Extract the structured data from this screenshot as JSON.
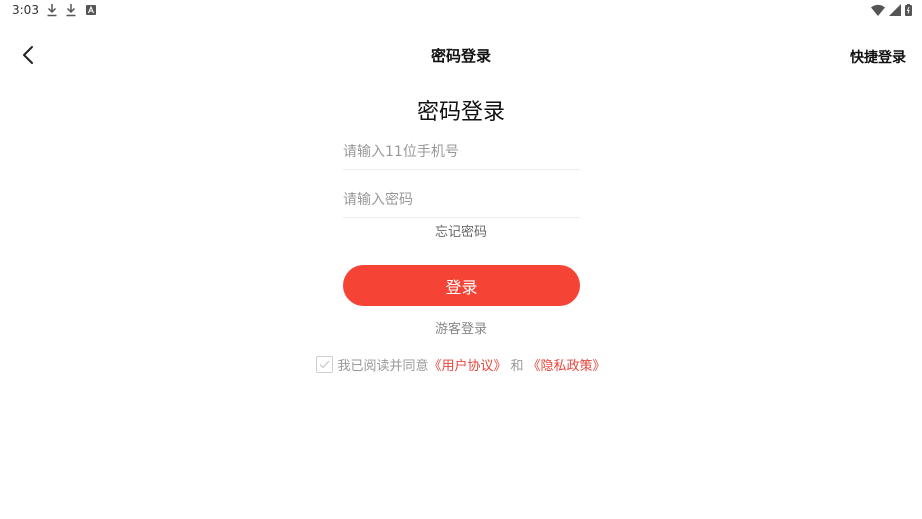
{
  "status_bar": {
    "time": "3:03"
  },
  "header": {
    "title": "密码登录",
    "quick_login": "快捷登录"
  },
  "form": {
    "title": "密码登录",
    "phone_placeholder": "请输入11位手机号",
    "password_placeholder": "请输入密码",
    "forgot_password": "忘记密码",
    "login_button": "登录",
    "guest_login": "游客登录"
  },
  "agreement": {
    "prefix": "我已阅读并同意",
    "user_agreement": "《用户协议》",
    "and": "和",
    "privacy_policy": "《隐私政策》"
  },
  "colors": {
    "accent": "#f54336",
    "link": "#e8453c"
  }
}
